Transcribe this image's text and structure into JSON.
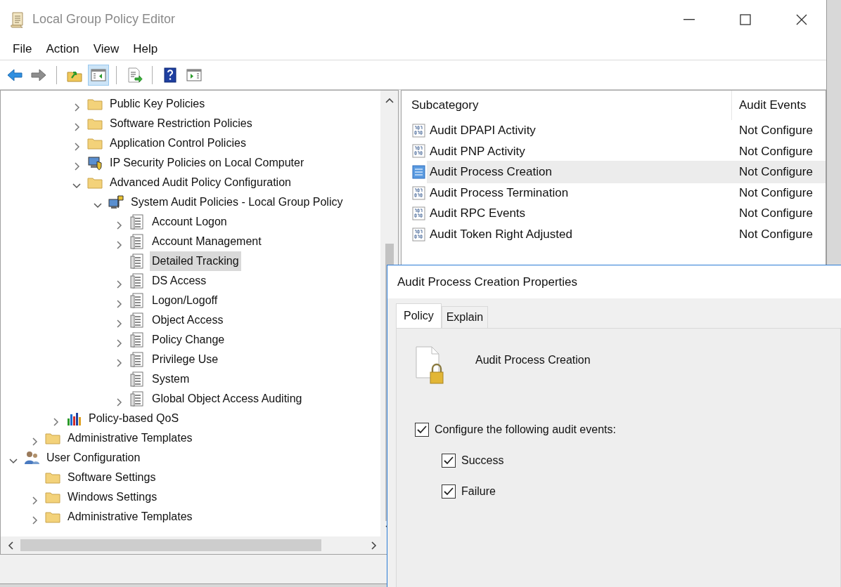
{
  "window": {
    "title": "Local Group Policy Editor"
  },
  "menu": [
    "File",
    "Action",
    "View",
    "Help"
  ],
  "toolbar": [
    {
      "kind": "back",
      "selected": false
    },
    {
      "kind": "forward",
      "selected": false
    },
    {
      "kind": "separator"
    },
    {
      "kind": "up",
      "selected": false
    },
    {
      "kind": "tree-toggle",
      "selected": true
    },
    {
      "kind": "separator"
    },
    {
      "kind": "export",
      "selected": false
    },
    {
      "kind": "separator"
    },
    {
      "kind": "help",
      "selected": false
    },
    {
      "kind": "action-pane",
      "selected": false
    }
  ],
  "tree": {
    "items": [
      {
        "children": [
          {
            "children": [
              {
                "children": [
                  {
                    "label": "Public Key Policies",
                    "kind": "folder",
                    "expanded": false,
                    "selected": false
                  },
                  {
                    "label": "Software Restriction Policies",
                    "kind": "folder",
                    "expanded": false,
                    "selected": false
                  },
                  {
                    "label": "Application Control Policies",
                    "kind": "folder",
                    "expanded": false,
                    "selected": false
                  },
                  {
                    "label": "IP Security Policies on Local Computer",
                    "kind": "ipsec",
                    "expanded": false,
                    "selected": false
                  },
                  {
                    "label": "Advanced Audit Policy Configuration",
                    "kind": "folder",
                    "expanded": true,
                    "selected": false,
                    "children": [
                      {
                        "label": "System Audit Policies - Local Group Policy",
                        "kind": "system-audit",
                        "expanded": true,
                        "selected": false,
                        "children": [
                          {
                            "label": "Account Logon",
                            "kind": "audit",
                            "expanded": false,
                            "selected": false
                          },
                          {
                            "label": "Account Management",
                            "kind": "audit",
                            "expanded": false,
                            "selected": false
                          },
                          {
                            "label": "Detailed Tracking",
                            "kind": "audit",
                            "selected": true
                          },
                          {
                            "label": "DS Access",
                            "kind": "audit",
                            "expanded": false,
                            "selected": false
                          },
                          {
                            "label": "Logon/Logoff",
                            "kind": "audit",
                            "expanded": false,
                            "selected": false
                          },
                          {
                            "label": "Object Access",
                            "kind": "audit",
                            "expanded": false,
                            "selected": false
                          },
                          {
                            "label": "Policy Change",
                            "kind": "audit",
                            "expanded": false,
                            "selected": false
                          },
                          {
                            "label": "Privilege Use",
                            "kind": "audit",
                            "expanded": false,
                            "selected": false
                          },
                          {
                            "label": "System",
                            "kind": "audit",
                            "selected": false
                          },
                          {
                            "label": "Global Object Access Auditing",
                            "kind": "audit",
                            "expanded": false,
                            "selected": false
                          }
                        ]
                      }
                    ]
                  }
                ]
              },
              {
                "label": "Policy-based QoS",
                "kind": "qos",
                "expanded": false,
                "selected": false
              }
            ]
          },
          {
            "label": "Administrative Templates",
            "kind": "folder",
            "expanded": false,
            "selected": false
          }
        ]
      },
      {
        "label": "User Configuration",
        "kind": "user",
        "expanded": true,
        "selected": false,
        "children": [
          {
            "label": "Software Settings",
            "kind": "folder",
            "selected": false
          },
          {
            "label": "Windows Settings",
            "kind": "folder",
            "expanded": false,
            "selected": false
          },
          {
            "label": "Administrative Templates",
            "kind": "folder",
            "expanded": false,
            "selected": false
          }
        ]
      }
    ]
  },
  "list": {
    "columns": [
      "Subcategory",
      "Audit Events"
    ],
    "rows": [
      {
        "subcategory": "Audit DPAPI Activity",
        "audit_events": "Not Configure",
        "selected": false
      },
      {
        "subcategory": "Audit PNP Activity",
        "audit_events": "Not Configure",
        "selected": false
      },
      {
        "subcategory": "Audit Process Creation",
        "audit_events": "Not Configure",
        "selected": true
      },
      {
        "subcategory": "Audit Process Termination",
        "audit_events": "Not Configure",
        "selected": false
      },
      {
        "subcategory": "Audit RPC Events",
        "audit_events": "Not Configure",
        "selected": false
      },
      {
        "subcategory": "Audit Token Right Adjusted",
        "audit_events": "Not Configure",
        "selected": false
      }
    ]
  },
  "dialog": {
    "title": "Audit Process Creation Properties",
    "tabs": [
      {
        "label": "Policy",
        "selected": true
      },
      {
        "label": "Explain",
        "selected": false
      }
    ],
    "policy_name": "Audit Process Creation",
    "configure": {
      "label": "Configure the following audit events:",
      "checked": true
    },
    "options": [
      {
        "label": "Success",
        "checked": true
      },
      {
        "label": "Failure",
        "checked": true
      }
    ]
  }
}
